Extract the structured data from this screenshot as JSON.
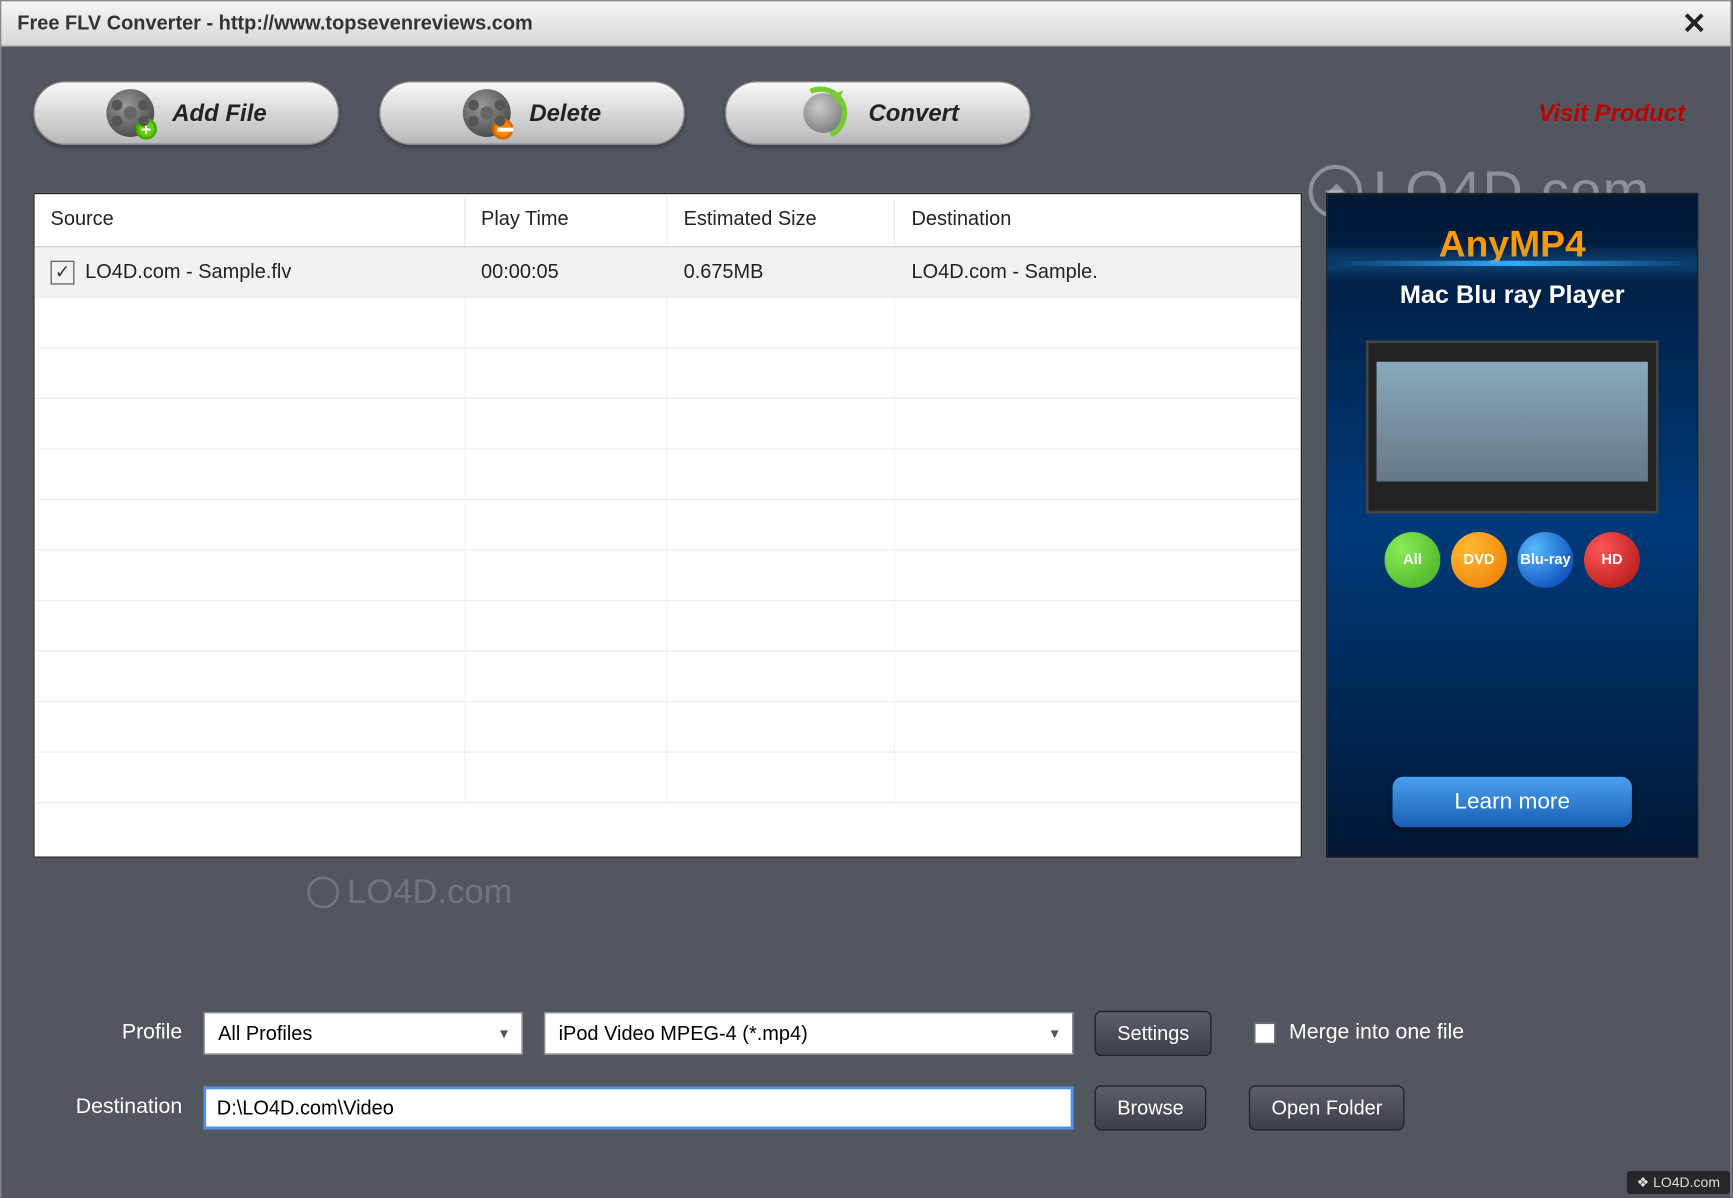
{
  "window": {
    "title": "Free FLV Converter - http://www.topsevenreviews.com"
  },
  "toolbar": {
    "add_label": "Add File",
    "delete_label": "Delete",
    "convert_label": "Convert",
    "visit_label": "Visit Product"
  },
  "table": {
    "headers": {
      "source": "Source",
      "playtime": "Play Time",
      "size": "Estimated Size",
      "dest": "Destination"
    },
    "rows": [
      {
        "checked": true,
        "source": "LO4D.com - Sample.flv",
        "playtime": "00:00:05",
        "size": "0.675MB",
        "dest": "LO4D.com - Sample."
      }
    ]
  },
  "ad": {
    "title": "AnyMP4",
    "subtitle": "Mac Blu ray Player",
    "learn_more": "Learn more",
    "badges": {
      "dvd": "DVD",
      "bluray": "Blu-ray",
      "hd": "HD",
      "all": "All"
    }
  },
  "form": {
    "profile_label": "Profile",
    "profile_category": "All Profiles",
    "profile_format": "iPod Video MPEG-4 (*.mp4)",
    "settings_label": "Settings",
    "merge_label": "Merge into one file",
    "merge_checked": false,
    "destination_label": "Destination",
    "destination_value": "D:\\LO4D.com\\Video",
    "browse_label": "Browse",
    "open_folder_label": "Open Folder"
  },
  "watermark": "LO4D.com",
  "corner_badge": "❖ LO4D.com"
}
